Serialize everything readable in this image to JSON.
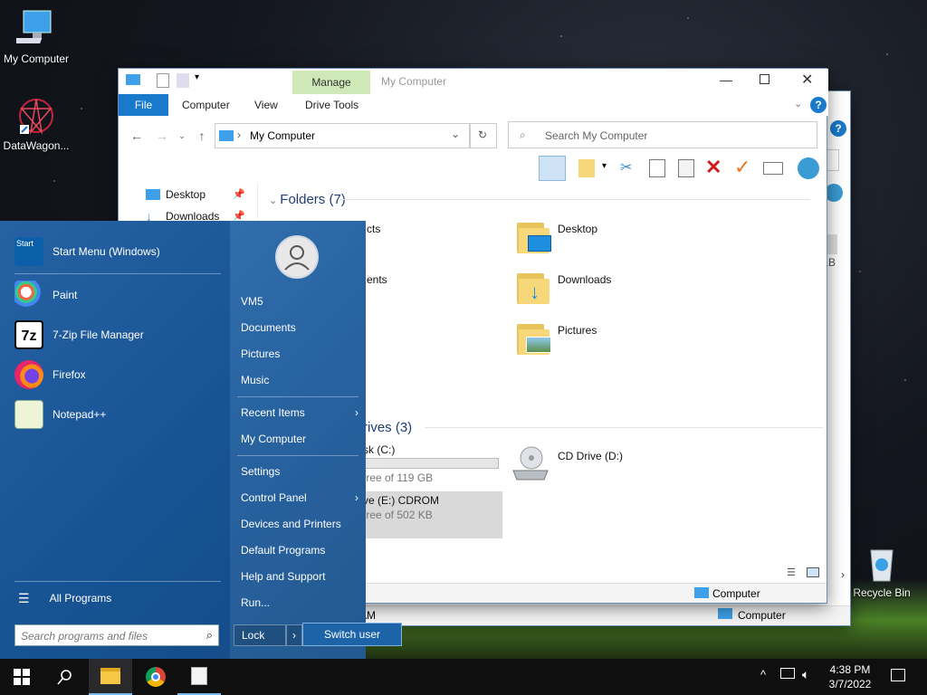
{
  "desktop": {
    "icons": [
      {
        "label": "My Computer"
      },
      {
        "label": "DataWagon..."
      },
      {
        "label": "Recycle Bin"
      }
    ]
  },
  "explorer_back": {
    "status": "Computer",
    "size_fragment": "KB",
    "time_fragment": "AM"
  },
  "explorer": {
    "title": "My Computer",
    "tabs": {
      "file": "File",
      "computer": "Computer",
      "view": "View",
      "manage": "Manage",
      "drive_tools": "Drive Tools"
    },
    "address": "My Computer",
    "search_placeholder": "Search My Computer",
    "nav": [
      {
        "label": "Desktop"
      },
      {
        "label": "Downloads"
      }
    ],
    "folders_header": "Folders (7)",
    "folders": [
      {
        "label": "cts"
      },
      {
        "label": "ents"
      },
      {
        "label": "Desktop"
      },
      {
        "label": "Downloads"
      },
      {
        "label": "Pictures"
      }
    ],
    "drives_header": "rives (3)",
    "drives": [
      {
        "label": "sk (C:)",
        "free": "free of 119 GB",
        "used_fraction": 0.0
      },
      {
        "label": "ve (E:) CDROM",
        "free": "free of 502 KB"
      },
      {
        "label": "CD Drive (D:)"
      }
    ],
    "status": "Computer"
  },
  "start_menu": {
    "programs": [
      {
        "label": "Start Menu (Windows)",
        "icon": "start-menu-icon"
      },
      {
        "label": "Paint",
        "icon": "paint-icon"
      },
      {
        "label": "7-Zip File Manager",
        "icon": "7zip-icon"
      },
      {
        "label": "Firefox",
        "icon": "firefox-icon"
      },
      {
        "label": "Notepad++",
        "icon": "notepadpp-icon"
      }
    ],
    "start_badge": "Start",
    "zip_badge": "7z",
    "all_programs": "All Programs",
    "search_placeholder": "Search programs and files",
    "right": [
      {
        "label": "VM5"
      },
      {
        "label": "Documents"
      },
      {
        "label": "Pictures"
      },
      {
        "label": "Music"
      },
      {
        "label": "Recent Items",
        "arrow": "›"
      },
      {
        "label": "My Computer"
      },
      {
        "label": "Settings"
      },
      {
        "label": "Control Panel",
        "arrow": "›"
      },
      {
        "label": "Devices and Printers"
      },
      {
        "label": "Default Programs"
      },
      {
        "label": "Help and Support"
      },
      {
        "label": "Run..."
      }
    ],
    "lock": "Lock",
    "lock_arrow": "›",
    "switch_user": "Switch user"
  },
  "taskbar": {
    "time": "4:38 PM",
    "date": "3/7/2022"
  },
  "colors": {
    "accent": "#1979ca",
    "start_bg": "#1b5b9c",
    "manage": "#cfe8b7"
  }
}
